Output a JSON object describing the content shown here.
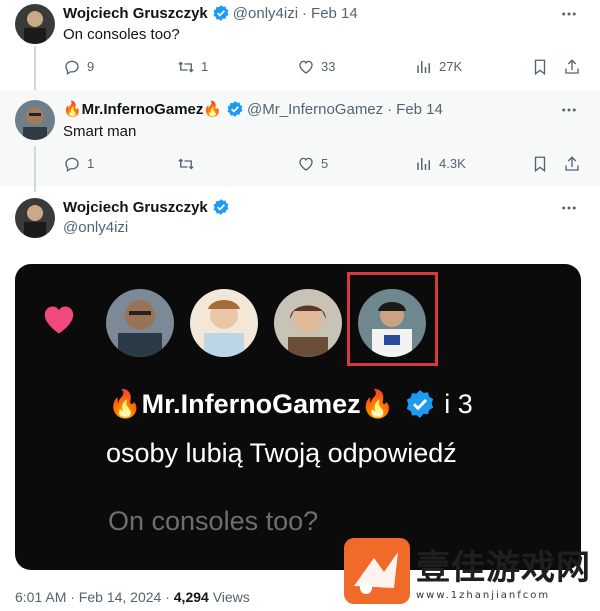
{
  "tweets": [
    {
      "name": "Wojciech Gruszczyk",
      "handle": "@only4izi",
      "date": "Feb 14",
      "text": "On consoles too?",
      "replies": "9",
      "retweets": "1",
      "likes": "33",
      "views": "27K"
    },
    {
      "name": "🔥Mr.InfernoGamez🔥",
      "handle": "@Mr_InfernoGamez",
      "date": "Feb 14",
      "text": "Smart man",
      "replies": "1",
      "retweets": "",
      "likes": "5",
      "views": "4.3K"
    }
  ],
  "main_tweet": {
    "name": "Wojciech Gruszczyk",
    "handle": "@only4izi",
    "timestamp": "6:01 AM · Feb 14, 2024 · ",
    "views_count": "4,294",
    "views_label": "Views"
  },
  "media": {
    "name_line": "🔥Mr.InfernoGamez🔥",
    "suffix": "i 3",
    "line2": "osoby lubią Twoją odpowiedź",
    "quote": "On consoles too?"
  },
  "watermark": {
    "title": "壹佳游戏网",
    "subtitle": "www.1zhanjianfcom"
  },
  "colors": {
    "verified": "#1d9bf0",
    "heart": "#f0487f",
    "highlight_box": "#d63a3a"
  }
}
